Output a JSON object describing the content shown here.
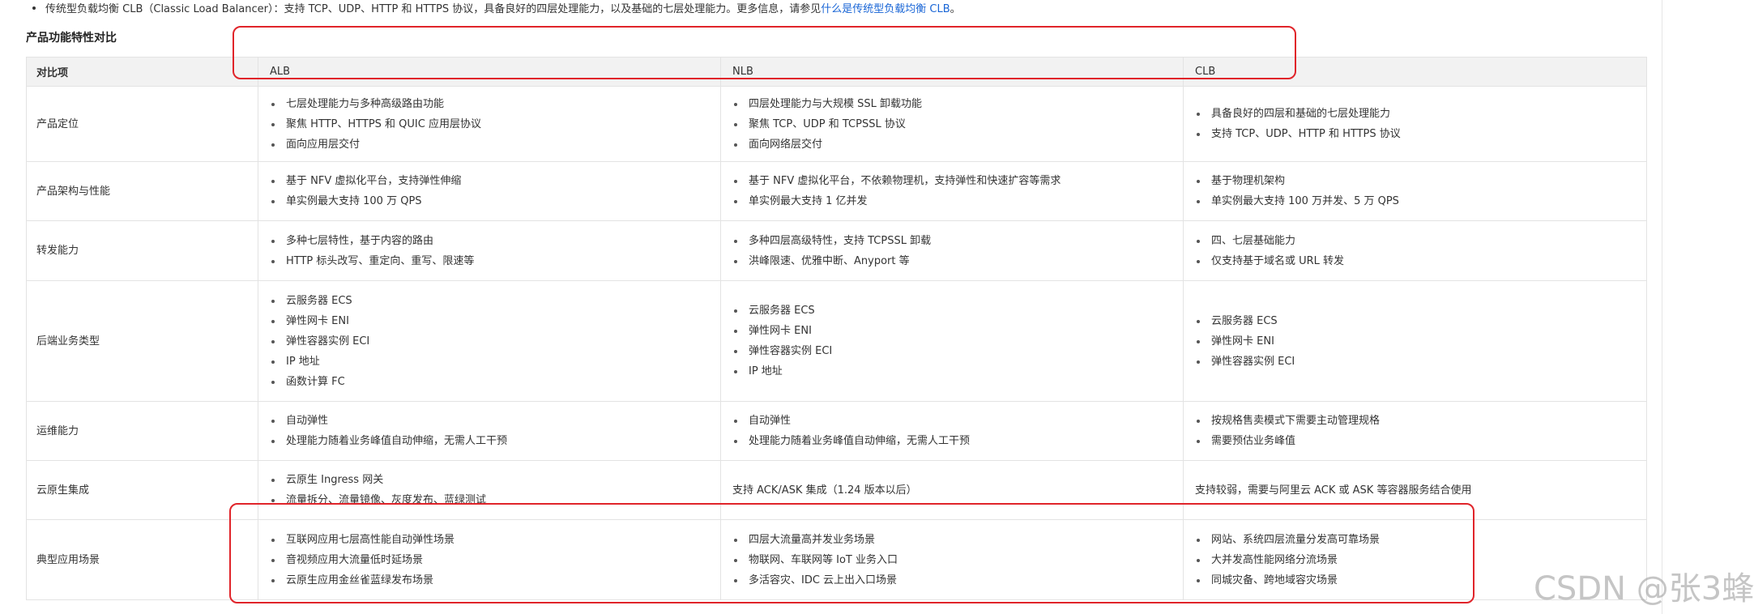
{
  "top_note": {
    "text": "传统型负载均衡 CLB（Classic Load Balancer）：支持 TCP、UDP、HTTP 和 HTTPS 协议，具备良好的四层处理能力，以及基础的七层处理能力。更多信息，请参见",
    "link": "什么是传统型负载均衡 CLB",
    "suffix": "。"
  },
  "section_title": "产品功能特性对比",
  "table": {
    "headers": [
      "对比项",
      "ALB",
      "NLB",
      "CLB"
    ],
    "rows": [
      {
        "label": "产品定位",
        "alb": [
          "七层处理能力与多种高级路由功能",
          "聚焦 HTTP、HTTPS 和 QUIC 应用层协议",
          "面向应用层交付"
        ],
        "nlb": [
          "四层处理能力与大规模 SSL 卸载功能",
          "聚焦 TCP、UDP 和 TCPSSL 协议",
          "面向网络层交付"
        ],
        "clb": [
          "具备良好的四层和基础的七层处理能力",
          "支持 TCP、UDP、HTTP 和 HTTPS 协议"
        ]
      },
      {
        "label": "产品架构与性能",
        "alb": [
          "基于 NFV 虚拟化平台，支持弹性伸缩",
          "单实例最大支持 100 万 QPS"
        ],
        "nlb": [
          "基于 NFV 虚拟化平台，不依赖物理机，支持弹性和快速扩容等需求",
          "单实例最大支持 1 亿并发"
        ],
        "clb": [
          "基于物理机架构",
          "单实例最大支持 100 万并发、5 万 QPS"
        ]
      },
      {
        "label": "转发能力",
        "alb": [
          "多种七层特性，基于内容的路由",
          "HTTP 标头改写、重定向、重写、限速等"
        ],
        "nlb": [
          "多种四层高级特性，支持 TCPSSL 卸载",
          "洪峰限速、优雅中断、Anyport 等"
        ],
        "clb": [
          "四、七层基础能力",
          "仅支持基于域名或 URL 转发"
        ]
      },
      {
        "label": "后端业务类型",
        "alb": [
          "云服务器 ECS",
          "弹性网卡 ENI",
          "弹性容器实例 ECI",
          "IP 地址",
          "函数计算 FC"
        ],
        "nlb": [
          "云服务器 ECS",
          "弹性网卡 ENI",
          "弹性容器实例 ECI",
          "IP 地址"
        ],
        "clb": [
          "云服务器 ECS",
          "弹性网卡 ENI",
          "弹性容器实例 ECI"
        ]
      },
      {
        "label": "运维能力",
        "alb": [
          "自动弹性",
          "处理能力随着业务峰值自动伸缩，无需人工干预"
        ],
        "nlb": [
          "自动弹性",
          "处理能力随着业务峰值自动伸缩，无需人工干预"
        ],
        "clb": [
          "按规格售卖模式下需要主动管理规格",
          "需要预估业务峰值"
        ]
      },
      {
        "label": "云原生集成",
        "alb": [
          "云原生 Ingress 网关",
          "流量拆分、流量镜像、灰度发布、蓝绿测试"
        ],
        "nlb_text": "支持 ACK/ASK 集成（1.24 版本以后）",
        "clb_text": "支持较弱，需要与阿里云 ACK 或 ASK 等容器服务结合使用"
      },
      {
        "label": "典型应用场景",
        "alb": [
          "互联网应用七层高性能自动弹性场景",
          "音视频应用大流量低时延场景",
          "云原生应用金丝雀蓝绿发布场景"
        ],
        "nlb": [
          "四层大流量高并发业务场景",
          "物联网、车联网等 IoT 业务入口",
          "多活容灾、IDC 云上出入口场景"
        ],
        "clb": [
          "网站、系统四层流量分发高可靠场景",
          "大并发高性能网络分流场景",
          "同城灾备、跨地域容灾场景"
        ]
      }
    ]
  },
  "watermark": "CSDN @张3蜂",
  "colors": {
    "highlight": "#e0242a",
    "link": "#1a66d6",
    "header_bg": "#f2f2f2",
    "border": "#e3e3e3"
  }
}
